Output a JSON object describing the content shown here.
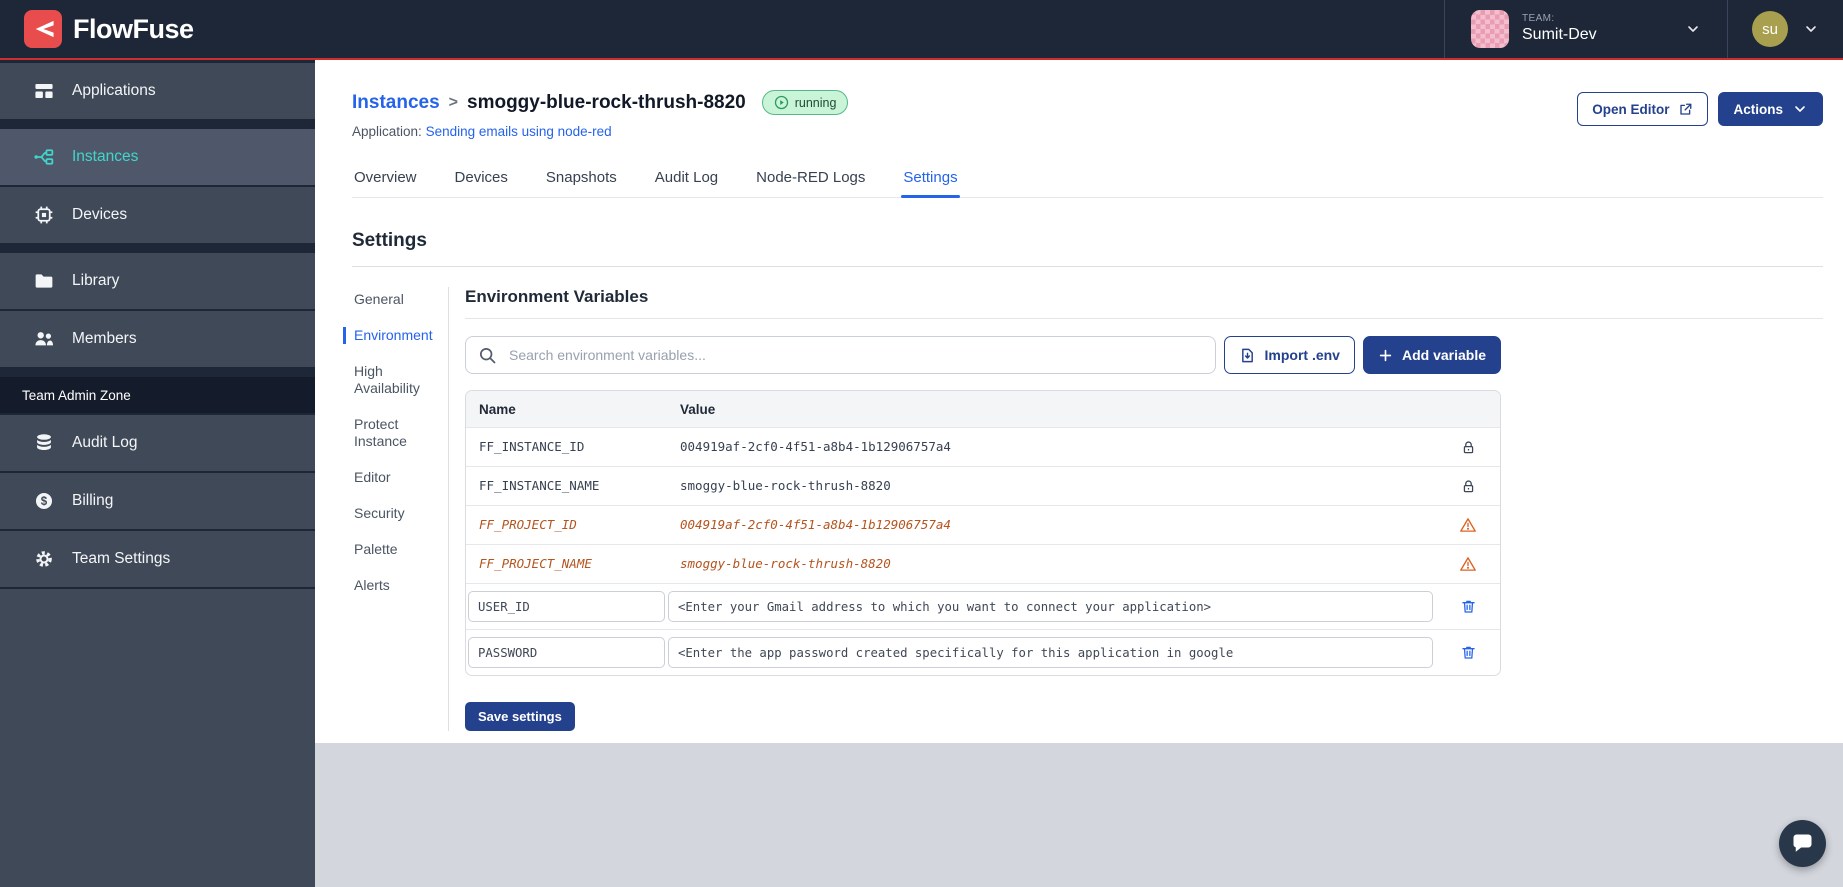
{
  "brand": {
    "name": "FlowFuse"
  },
  "topbar": {
    "team_label": "TEAM:",
    "team_name": "Sumit-Dev",
    "user_initials": "su"
  },
  "sidebar": {
    "groups": [
      [
        {
          "label": "Applications",
          "icon": "applications-icon"
        }
      ],
      [
        {
          "label": "Instances",
          "icon": "instances-icon",
          "active": true
        },
        {
          "label": "Devices",
          "icon": "devices-icon"
        }
      ],
      [
        {
          "label": "Library",
          "icon": "library-icon"
        },
        {
          "label": "Members",
          "icon": "members-icon"
        }
      ]
    ],
    "admin_zone_label": "Team Admin Zone",
    "admin_items": [
      {
        "label": "Audit Log",
        "icon": "audit-log-icon"
      },
      {
        "label": "Billing",
        "icon": "billing-icon"
      },
      {
        "label": "Team Settings",
        "icon": "team-settings-icon"
      }
    ]
  },
  "header": {
    "breadcrumb": "Instances",
    "separator": ">",
    "instance_name": "smoggy-blue-rock-thrush-8820",
    "status_badge": "running",
    "application_label": "Application:",
    "application_name": "Sending emails using node-red",
    "open_editor_label": "Open Editor",
    "actions_label": "Actions"
  },
  "tabs": {
    "items": [
      "Overview",
      "Devices",
      "Snapshots",
      "Audit Log",
      "Node-RED Logs",
      "Settings"
    ],
    "active": "Settings"
  },
  "settings": {
    "title": "Settings",
    "nav": {
      "items": [
        "General",
        "Environment",
        "High Availability",
        "Protect Instance",
        "Editor",
        "Security",
        "Palette",
        "Alerts"
      ],
      "active": "Environment"
    },
    "env": {
      "title": "Environment Variables",
      "search_placeholder": "Search environment variables...",
      "import_label": "Import .env",
      "add_label": "Add variable",
      "save_label": "Save settings",
      "table": {
        "columns": [
          "Name",
          "Value"
        ],
        "rows": [
          {
            "name": "FF_INSTANCE_ID",
            "value": "004919af-2cf0-4f51-a8b4-1b12906757a4",
            "state": "locked"
          },
          {
            "name": "FF_INSTANCE_NAME",
            "value": "smoggy-blue-rock-thrush-8820",
            "state": "locked"
          },
          {
            "name": "FF_PROJECT_ID",
            "value": "004919af-2cf0-4f51-a8b4-1b12906757a4",
            "state": "deprecated"
          },
          {
            "name": "FF_PROJECT_NAME",
            "value": "smoggy-blue-rock-thrush-8820",
            "state": "deprecated"
          },
          {
            "name": "USER_ID",
            "value": "<Enter your Gmail address to which you want to connect your application>",
            "state": "editable"
          },
          {
            "name": "PASSWORD",
            "value": "<Enter the app password created specifically for this application in google",
            "state": "editable"
          }
        ]
      }
    }
  },
  "colors": {
    "accent_red": "#cd2f2f",
    "logo_red": "#e84c4c",
    "active_blue": "#2563eb",
    "navy_button": "#24418e",
    "sidebar_teal": "#41d6c9",
    "badge_green_bg": "#c9f4d7",
    "badge_green_text": "#1d4d35",
    "deprecated_orange": "#b4541f"
  }
}
